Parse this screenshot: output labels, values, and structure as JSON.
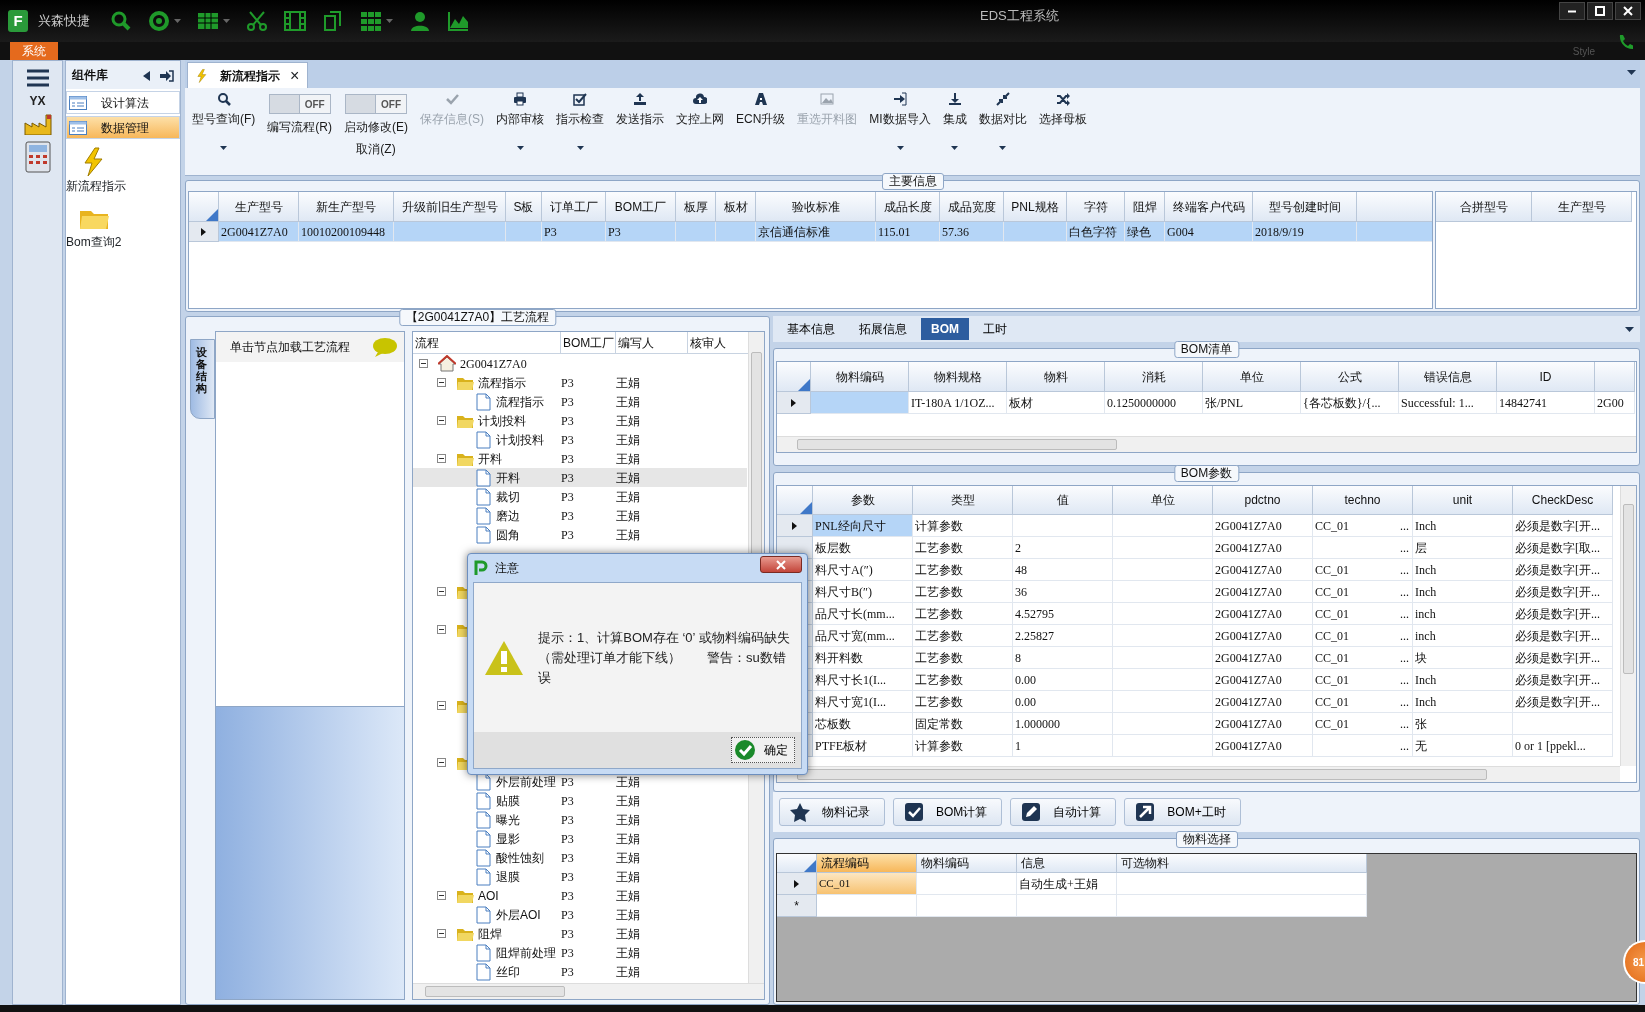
{
  "titlebar": {
    "logo": "F",
    "app_name": "兴森快捷",
    "title": "EDS工程系统",
    "style_label": "Style"
  },
  "system_tab": "系统",
  "rail": {
    "logo_text": "YX"
  },
  "component_panel": {
    "title": "组件库",
    "items": [
      {
        "label": "设计算法",
        "selected": false
      },
      {
        "label": "数据管理",
        "selected": true
      }
    ],
    "tiles": [
      {
        "label": "新流程指示",
        "kind": "bolt"
      },
      {
        "label": "Bom查询2",
        "kind": "folder"
      }
    ]
  },
  "doc_tabs": [
    {
      "label": "新流程指示",
      "close": "×",
      "selected": true
    }
  ],
  "toolbar": [
    {
      "kind": "button",
      "label": "型号查询(F)",
      "dropdown": true,
      "disabled": false
    },
    {
      "kind": "toggle",
      "label": "编写流程(R)",
      "state_text": "OFF",
      "on": false
    },
    {
      "kind": "toggle",
      "label": "启动修改(E)",
      "sublabel": "取消(Z)",
      "state_text": "OFF",
      "on": false
    },
    {
      "kind": "button",
      "label": "保存信息(S)",
      "dropdown": false,
      "disabled": true
    },
    {
      "kind": "button",
      "label": "内部审核",
      "dropdown": true,
      "disabled": false
    },
    {
      "kind": "button",
      "label": "指示检查",
      "dropdown": true,
      "disabled": false
    },
    {
      "kind": "button",
      "label": "发送指示",
      "dropdown": false,
      "disabled": false
    },
    {
      "kind": "button",
      "label": "文控上网",
      "dropdown": false,
      "disabled": false
    },
    {
      "kind": "button",
      "label": "ECN升级",
      "dropdown": false,
      "disabled": false
    },
    {
      "kind": "button",
      "label": "重选开料图",
      "dropdown": false,
      "disabled": true
    },
    {
      "kind": "button",
      "label": "MI数据导入",
      "dropdown": true,
      "disabled": false
    },
    {
      "kind": "button",
      "label": "集成",
      "dropdown": true,
      "disabled": false
    },
    {
      "kind": "button",
      "label": "数据对比",
      "dropdown": true,
      "disabled": false
    },
    {
      "kind": "button",
      "label": "选择母板",
      "dropdown": false,
      "disabled": false
    }
  ],
  "main_info": {
    "title": "主要信息",
    "columns": [
      "生产型号",
      "新生产型号",
      "升级前旧生产型号",
      "S板",
      "订单工厂",
      "BOM工厂",
      "板厚",
      "板材",
      "验收标准",
      "成品长度",
      "成品宽度",
      "PNL规格",
      "字符",
      "阻焊",
      "终端客户代码",
      "型号创建时间"
    ],
    "rows": [
      {
        "selected": true,
        "cells": [
          "2G0041Z7A0",
          "10010200109448",
          null,
          null,
          "P3",
          "P3",
          null,
          null,
          "京信通信标准",
          "115.01",
          "57.36",
          null,
          "白色字符",
          "绿色",
          "G004",
          "2018/9/19"
        ]
      }
    ]
  },
  "merge_table": {
    "columns": [
      "合拼型号",
      "生产型号"
    ]
  },
  "process": {
    "title": "【2G0041Z7A0】工艺流程",
    "side_tab": "设备结构",
    "hint": "单击节点加载工艺流程",
    "columns": [
      "流程",
      "BOM工厂",
      "编写人",
      "核审人"
    ],
    "tree": [
      {
        "kind": "home",
        "label": "2G0041Z7A0",
        "expanded": true,
        "selected": false,
        "children": [
          {
            "kind": "folder",
            "label": "流程指示",
            "factory": "P3",
            "writer": "王娟",
            "expanded": true,
            "selected": false,
            "children": [
              {
                "kind": "doc",
                "label": "流程指示",
                "factory": "P3",
                "writer": "王娟",
                "selected": false
              }
            ]
          },
          {
            "kind": "folder",
            "label": "计划投料",
            "factory": "P3",
            "writer": "王娟",
            "expanded": true,
            "selected": false,
            "children": [
              {
                "kind": "doc",
                "label": "计划投料",
                "factory": "P3",
                "writer": "王娟",
                "selected": false
              }
            ]
          },
          {
            "kind": "folder",
            "label": "开料",
            "factory": "P3",
            "writer": "王娟",
            "expanded": true,
            "selected": false,
            "children": [
              {
                "kind": "doc",
                "label": "开料",
                "factory": "P3",
                "writer": "王娟",
                "selected": true
              },
              {
                "kind": "doc",
                "label": "裁切",
                "factory": "P3",
                "writer": "王娟",
                "selected": false
              },
              {
                "kind": "doc",
                "label": "磨边",
                "factory": "P3",
                "writer": "王娟",
                "selected": false
              },
              {
                "kind": "doc",
                "label": "圆角",
                "factory": "P3",
                "writer": "王娟",
                "selected": false
              },
              {
                "kind": "doc",
                "selected": false
              },
              {
                "kind": "doc",
                "selected": false
              }
            ]
          },
          {
            "kind": "folder",
            "expanded": true,
            "selected": false,
            "children": [
              {
                "kind": "doc",
                "selected": false
              }
            ]
          },
          {
            "kind": "folder",
            "expanded": true,
            "selected": false,
            "children": [
              {
                "kind": "doc",
                "selected": false
              },
              {
                "kind": "doc",
                "selected": false
              },
              {
                "kind": "doc",
                "selected": false
              }
            ]
          },
          {
            "kind": "folder",
            "expanded": true,
            "selected": false,
            "children": [
              {
                "kind": "doc",
                "selected": false
              },
              {
                "kind": "doc",
                "selected": false
              }
            ]
          },
          {
            "kind": "folder",
            "expanded": true,
            "selected": false,
            "children": [
              {
                "kind": "doc",
                "label": "外层前处理",
                "factory": "P3",
                "writer": "王娟",
                "selected": false
              },
              {
                "kind": "doc",
                "label": "贴膜",
                "factory": "P3",
                "writer": "王娟",
                "selected": false
              },
              {
                "kind": "doc",
                "label": "曝光",
                "factory": "P3",
                "writer": "王娟",
                "selected": false
              },
              {
                "kind": "doc",
                "label": "显影",
                "factory": "P3",
                "writer": "王娟",
                "selected": false
              },
              {
                "kind": "doc",
                "label": "酸性蚀刻",
                "factory": "P3",
                "writer": "王娟",
                "selected": false
              },
              {
                "kind": "doc",
                "label": "退膜",
                "factory": "P3",
                "writer": "王娟",
                "selected": false
              }
            ]
          },
          {
            "kind": "folder",
            "label": "AOI",
            "factory": "P3",
            "writer": "王娟",
            "expanded": true,
            "selected": false,
            "children": [
              {
                "kind": "doc",
                "label": "外层AOI",
                "factory": "P3",
                "writer": "王娟",
                "selected": false
              }
            ]
          },
          {
            "kind": "folder",
            "label": "阻焊",
            "factory": "P3",
            "writer": "王娟",
            "expanded": true,
            "selected": false,
            "children": [
              {
                "kind": "doc",
                "label": "阻焊前处理",
                "factory": "P3",
                "writer": "王娟",
                "selected": false
              },
              {
                "kind": "doc",
                "label": "丝印",
                "factory": "P3",
                "writer": "王娟",
                "selected": false
              }
            ]
          }
        ]
      }
    ]
  },
  "detail_tabs": [
    {
      "label": "基本信息",
      "selected": false
    },
    {
      "label": "拓展信息",
      "selected": false
    },
    {
      "label": "BOM",
      "selected": true
    },
    {
      "label": "工时",
      "selected": false
    }
  ],
  "bom_list": {
    "title": "BOM清单",
    "columns": [
      "物料编码",
      "物料规格",
      "物料",
      "消耗",
      "单位",
      "公式",
      "错误信息",
      "ID"
    ],
    "rows": [
      {
        "selected": true,
        "cells": [
          null,
          "IT-180A 1/1OZ...",
          "板材",
          "0.1250000000",
          "张/PNL",
          "{各芯板数}/{...",
          "Successful: 1...",
          "14842741",
          "2G00"
        ]
      }
    ]
  },
  "bom_params": {
    "title": "BOM参数",
    "columns": [
      "参数",
      "类型",
      "值",
      "单位",
      "pdctno",
      "techno",
      "unit",
      "CheckDesc"
    ],
    "rows": [
      {
        "selected": true,
        "cells": [
          "PNL经向尺寸",
          "计算参数",
          null,
          null,
          "2G0041Z7A0",
          "CC_01",
          "Inch",
          "必须是数字[开..."
        ],
        "more": "..."
      },
      {
        "selected": false,
        "cells": [
          "板层数",
          "工艺参数",
          "2",
          null,
          "2G0041Z7A0",
          null,
          "层",
          "必须是数字[取..."
        ],
        "more": "..."
      },
      {
        "selected": false,
        "cells": [
          "料尺寸A(″)",
          "工艺参数",
          "48",
          null,
          "2G0041Z7A0",
          "CC_01",
          "Inch",
          "必须是数字[开..."
        ],
        "more": "..."
      },
      {
        "selected": false,
        "cells": [
          "料尺寸B(″)",
          "工艺参数",
          "36",
          null,
          "2G0041Z7A0",
          "CC_01",
          "Inch",
          "必须是数字[开..."
        ],
        "more": "..."
      },
      {
        "selected": false,
        "cells": [
          "品尺寸长(mm...",
          "工艺参数",
          "4.52795",
          null,
          "2G0041Z7A0",
          "CC_01",
          "inch",
          "必须是数字[开..."
        ],
        "more": "..."
      },
      {
        "selected": false,
        "cells": [
          "品尺寸宽(mm...",
          "工艺参数",
          "2.25827",
          null,
          "2G0041Z7A0",
          "CC_01",
          "inch",
          "必须是数字[开..."
        ],
        "more": "..."
      },
      {
        "selected": false,
        "cells": [
          "料开料数",
          "工艺参数",
          "8",
          null,
          "2G0041Z7A0",
          "CC_01",
          "块",
          "必须是数字[开..."
        ],
        "more": "..."
      },
      {
        "selected": false,
        "cells": [
          "料尺寸长1(I...",
          "工艺参数",
          "0.00",
          null,
          "2G0041Z7A0",
          "CC_01",
          "Inch",
          "必须是数字[开..."
        ],
        "more": "..."
      },
      {
        "selected": false,
        "cells": [
          "料尺寸宽1(I...",
          "工艺参数",
          "0.00",
          null,
          "2G0041Z7A0",
          "CC_01",
          "Inch",
          "必须是数字[开..."
        ],
        "more": "..."
      },
      {
        "selected": false,
        "cells": [
          "芯板数",
          "固定常数",
          "1.000000",
          null,
          "2G0041Z7A0",
          "CC_01",
          "张",
          null
        ],
        "more": "..."
      },
      {
        "selected": false,
        "cells": [
          "PTFE板材",
          "计算参数",
          "1",
          null,
          "2G0041Z7A0",
          null,
          "无",
          "0 or 1 [ppekl..."
        ],
        "more": "..."
      }
    ]
  },
  "actions": [
    {
      "label": "物料记录"
    },
    {
      "label": "BOM计算"
    },
    {
      "label": "自动计算"
    },
    {
      "label": "BOM+工时"
    }
  ],
  "material_select": {
    "title": "物料选择",
    "columns": [
      {
        "label": "流程编码",
        "selected": true
      },
      {
        "label": "物料编码",
        "selected": false
      },
      {
        "label": "信息",
        "selected": false
      },
      {
        "label": "可选物料",
        "selected": false
      }
    ],
    "rows": [
      {
        "selected": true,
        "cells": [
          "CC_01",
          null,
          "自动生成+王娟",
          null
        ]
      }
    ],
    "new_row_marker": "*"
  },
  "dialog": {
    "title": "注意",
    "message": "提示：1、计算BOM存在 ‘0’ 或物料编码缺失（需处理订单才能下线）　　警告：su数错误",
    "ok": "确定"
  },
  "floating_badge": "81"
}
